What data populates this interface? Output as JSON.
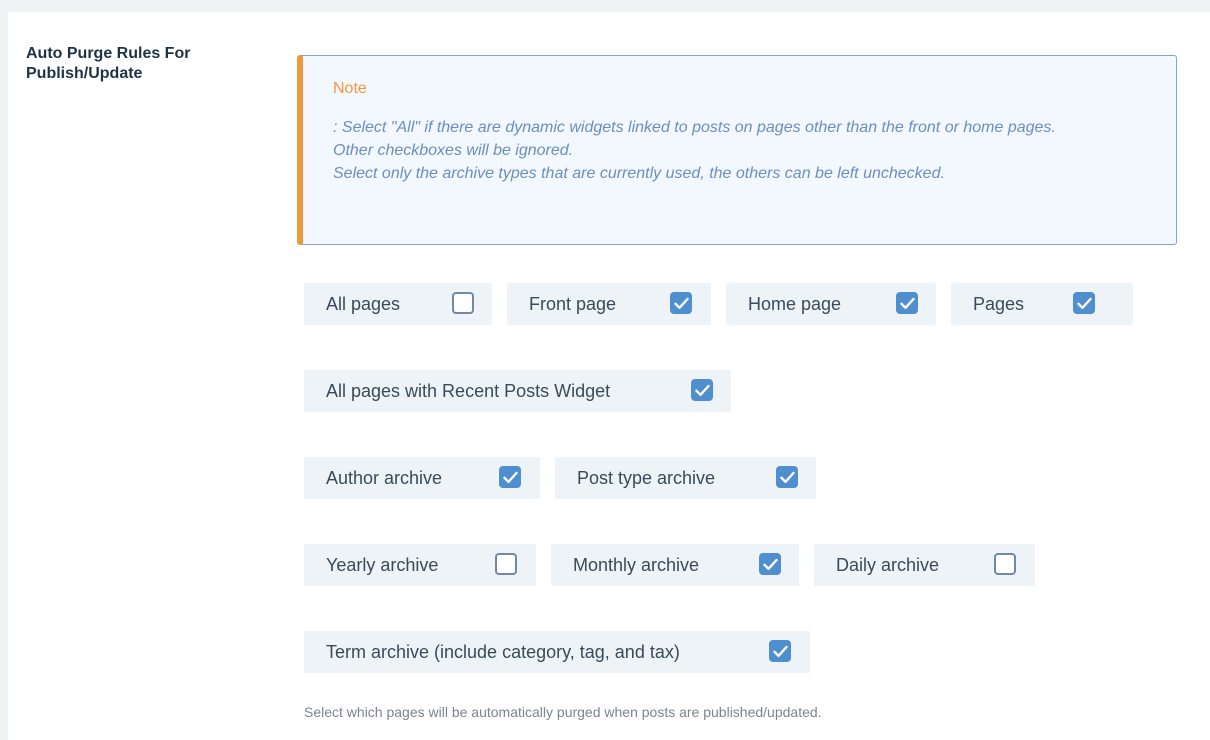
{
  "section": {
    "label": "Auto Purge Rules For Publish/Update",
    "label_line1": "Auto Purge Rules For",
    "label_line2": "Publish/Update"
  },
  "note": {
    "title": "Note",
    "lines": [
      ": Select \"All\" if there are dynamic widgets linked to posts on pages other than the front or home pages.",
      "Other checkboxes will be ignored.",
      "Select only the archive types that are currently used, the others can be left unchecked."
    ]
  },
  "options": {
    "all_pages": {
      "label": "All pages",
      "checked": false
    },
    "front_page": {
      "label": "Front page",
      "checked": true
    },
    "home_page": {
      "label": "Home page",
      "checked": true
    },
    "pages": {
      "label": "Pages",
      "checked": true
    },
    "recent_posts_widget": {
      "label": "All pages with Recent Posts Widget",
      "checked": true
    },
    "author_archive": {
      "label": "Author archive",
      "checked": true
    },
    "post_type_archive": {
      "label": "Post type archive",
      "checked": true
    },
    "yearly_archive": {
      "label": "Yearly archive",
      "checked": false
    },
    "monthly_archive": {
      "label": "Monthly archive",
      "checked": true
    },
    "daily_archive": {
      "label": "Daily archive",
      "checked": false
    },
    "term_archive": {
      "label": "Term archive (include category, tag, and tax)",
      "checked": true
    }
  },
  "hint": "Select which pages will be automatically purged when posts are published/updated.",
  "colors": {
    "accent": "#4f8fd0",
    "note_border": "#f0993a",
    "note_text": "#6b8ec2"
  }
}
